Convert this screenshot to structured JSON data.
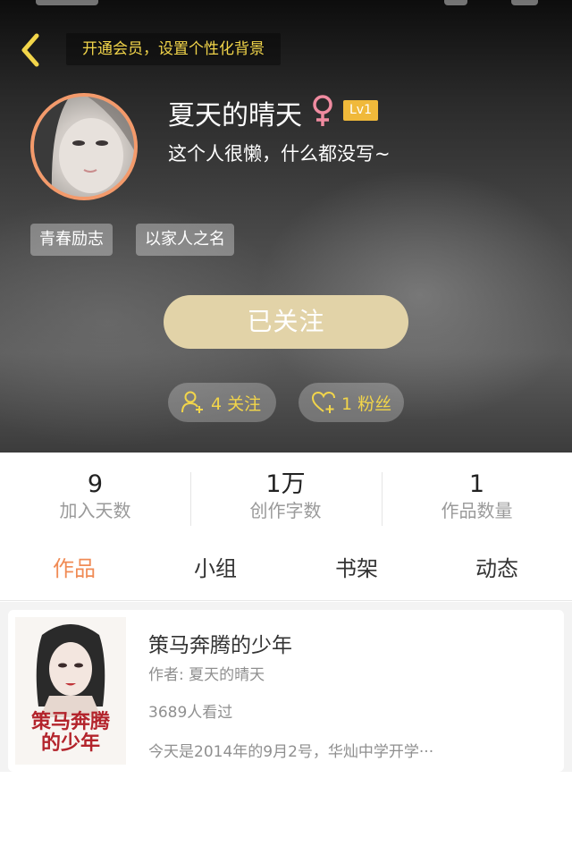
{
  "header": {
    "vip_banner": "开通会员，设置个性化背景"
  },
  "profile": {
    "username": "夏天的晴天",
    "gender": "female",
    "level": "Lv1",
    "bio": "这个人很懒，什么都没写~",
    "tags": [
      "青春励志",
      "以家人之名"
    ],
    "follow_button": "已关注",
    "following": "4 关注",
    "followers": "1 粉丝"
  },
  "stats": [
    {
      "value": "9",
      "label": "加入天数"
    },
    {
      "value": "1万",
      "label": "创作字数"
    },
    {
      "value": "1",
      "label": "作品数量"
    }
  ],
  "tabs": [
    {
      "label": "作品",
      "active": true
    },
    {
      "label": "小组",
      "active": false
    },
    {
      "label": "书架",
      "active": false
    },
    {
      "label": "动态",
      "active": false
    }
  ],
  "works": [
    {
      "title": "策马奔腾的少年",
      "author": "作者: 夏天的晴天",
      "views": "3689人看过",
      "excerpt": "今天是2014年的9月2号，华灿中学开学···",
      "cover_title": "策马奔腾的少年"
    }
  ],
  "colors": {
    "accent_gold": "#f2d54a",
    "active_tab": "#f08b55",
    "level_badge": "#f0b93a",
    "follow_button": "#e2d3a8",
    "avatar_ring": "#f39a6b"
  }
}
